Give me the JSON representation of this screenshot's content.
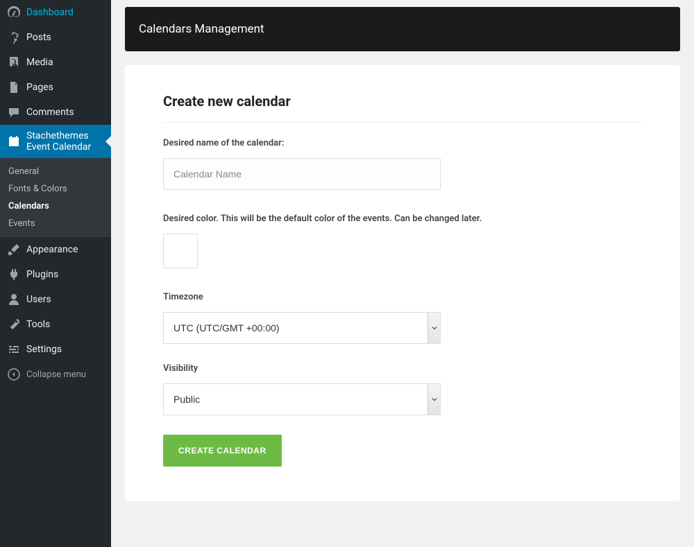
{
  "sidebar": {
    "items": [
      {
        "label": "Dashboard"
      },
      {
        "label": "Posts"
      },
      {
        "label": "Media"
      },
      {
        "label": "Pages"
      },
      {
        "label": "Comments"
      },
      {
        "label": "Stachethemes Event Calendar"
      },
      {
        "label": "Appearance"
      },
      {
        "label": "Plugins"
      },
      {
        "label": "Users"
      },
      {
        "label": "Tools"
      },
      {
        "label": "Settings"
      }
    ],
    "sub": [
      {
        "label": "General"
      },
      {
        "label": "Fonts & Colors"
      },
      {
        "label": "Calendars"
      },
      {
        "label": "Events"
      }
    ],
    "collapse": "Collapse menu"
  },
  "header": {
    "title": "Calendars Management"
  },
  "form": {
    "heading": "Create new calendar",
    "name_label": "Desired name of the calendar:",
    "name_placeholder": "Calendar Name",
    "color_label": "Desired color. This will be the default color of the events. Can be changed later.",
    "timezone_label": "Timezone",
    "timezone_value": "UTC (UTC/GMT +00:00)",
    "visibility_label": "Visibility",
    "visibility_value": "Public",
    "submit_label": "CREATE CALENDAR"
  }
}
